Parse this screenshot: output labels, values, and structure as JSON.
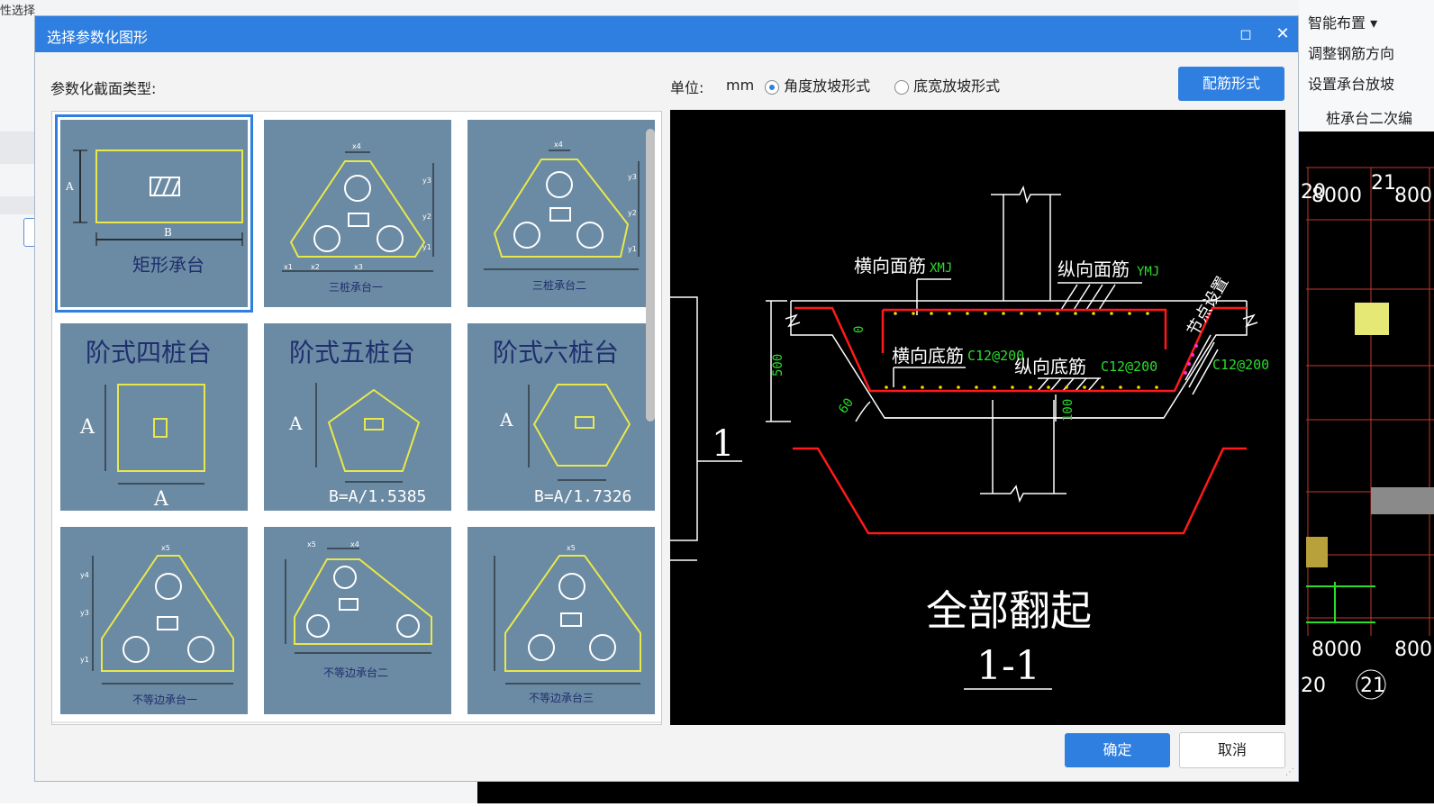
{
  "background_app": {
    "ribbon_fragments": [
      "性选择"
    ],
    "right_menu": {
      "items": [
        "智能布置",
        "调整钢筋方向",
        "设置承台放坡",
        "桩承台二次编"
      ]
    },
    "cad_labels": [
      "20",
      "21",
      "8000",
      "800",
      "8000",
      "800",
      "20",
      "21"
    ]
  },
  "dialog": {
    "title": "选择参数化图形",
    "section_label": "参数化截面类型:",
    "unit_label": "单位:",
    "unit_value": "mm",
    "radio_options": [
      {
        "label": "角度放坡形式",
        "checked": true
      },
      {
        "label": "底宽放坡形式",
        "checked": false
      }
    ],
    "rebar_button": "配筋形式",
    "ok_button": "确定",
    "cancel_button": "取消",
    "shapes": [
      {
        "caption": "矩形承台",
        "selected": true
      },
      {
        "caption": "三桩承台一"
      },
      {
        "caption": "三桩承台二"
      },
      {
        "caption": "阶式四桩台",
        "dim_a": "A",
        "dim_b": "A"
      },
      {
        "caption": "阶式五桩台",
        "dim_a": "A",
        "dim_b": "B=A/1.5385"
      },
      {
        "caption": "阶式六桩台",
        "dim_a": "A",
        "dim_b": "B=A/1.7326"
      },
      {
        "caption": "不等边承台一"
      },
      {
        "caption": "不等边承台二"
      },
      {
        "caption": "不等边承台三"
      }
    ],
    "tile_small_labels": {
      "rect_a": "A",
      "rect_b": "B",
      "x": [
        "x1",
        "x2",
        "x3",
        "x4",
        "x5"
      ],
      "y": [
        "y1",
        "y2",
        "y3",
        "y4"
      ]
    },
    "preview": {
      "label_transverse_top": "横向面筋",
      "code_transverse_top": "XMJ",
      "label_longitudinal_top": "纵向面筋",
      "code_longitudinal_top": "YMJ",
      "label_node": "节点设置",
      "label_transverse_bottom": "横向底筋",
      "code_transverse_bottom": "C12@200",
      "label_longitudinal_bottom": "纵向底筋",
      "code_longitudinal_bottom": "C12@200",
      "code_side": "C12@200",
      "dim_500": "500",
      "dim_0": "0",
      "dim_60": "60",
      "dim_100": "100",
      "section_mark": "1",
      "caption": "全部翻起",
      "section_name": "1-1"
    }
  },
  "colors": {
    "titlebar": "#2f7fe0",
    "tile_bg": "#6b8aa3",
    "shape_line": "#e8e84a",
    "rebar_red": "#ff1a1a",
    "cad_green": "#2bdc2b",
    "rebar_dots": "#ffd400"
  }
}
